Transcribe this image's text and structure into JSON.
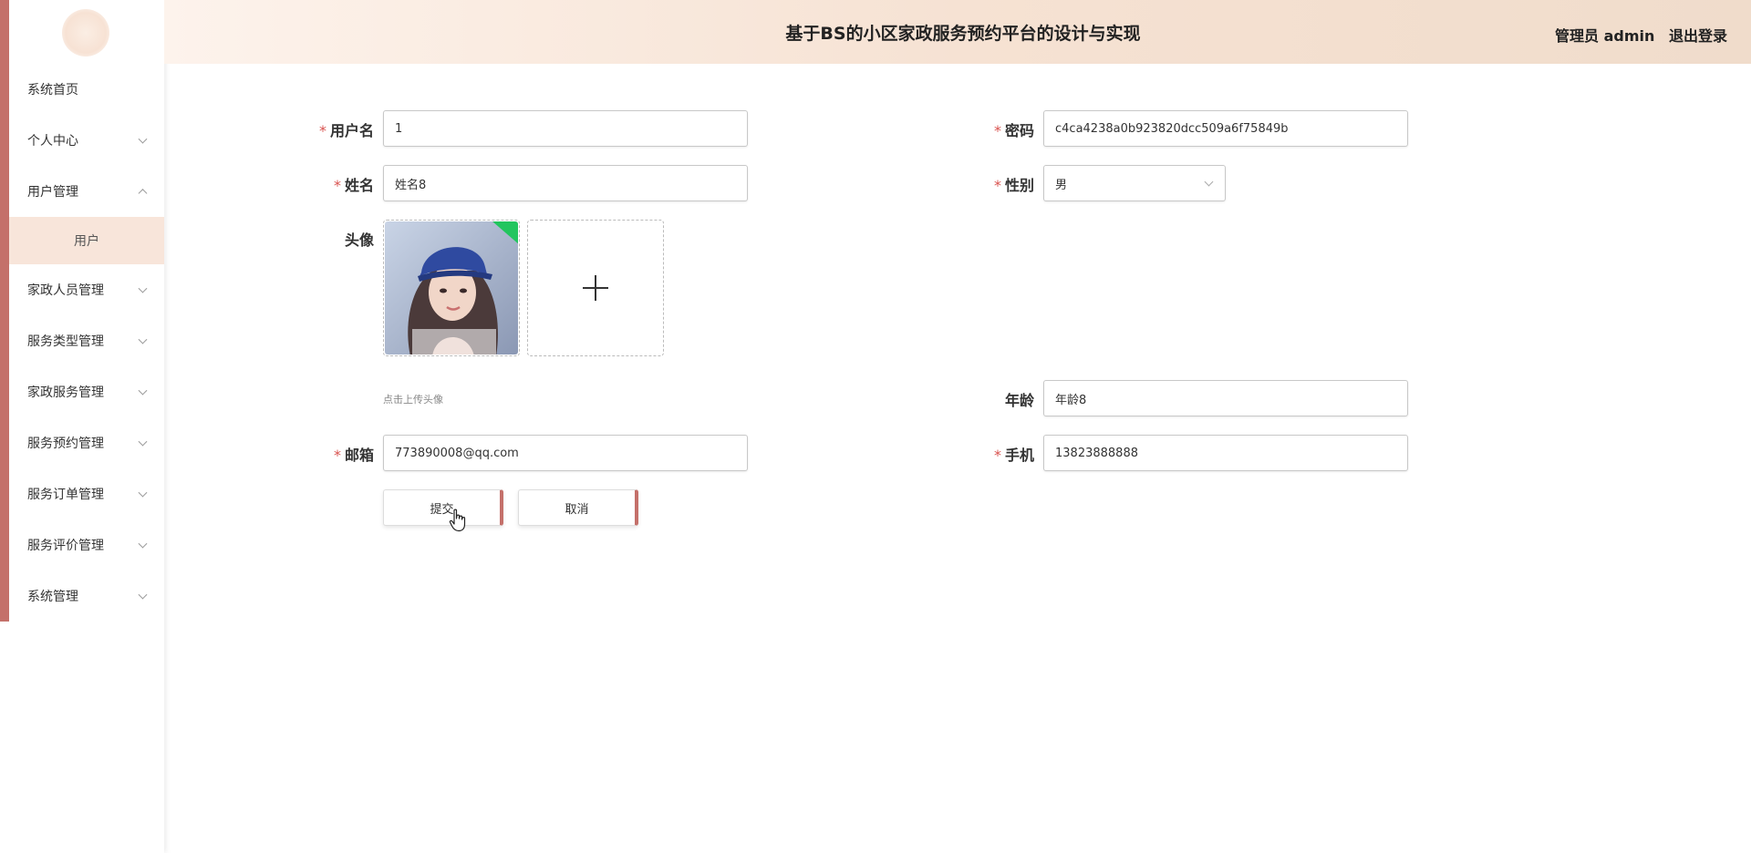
{
  "header": {
    "title": "基于BS的小区家政服务预约平台的设计与实现",
    "user_role": "管理员 admin",
    "logout_label": "退出登录"
  },
  "sidebar": {
    "items": [
      {
        "label": "系统首页",
        "has_children": false
      },
      {
        "label": "个人中心",
        "has_children": true,
        "expanded": false
      },
      {
        "label": "用户管理",
        "has_children": true,
        "expanded": true
      },
      {
        "label": "家政人员管理",
        "has_children": true,
        "expanded": false
      },
      {
        "label": "服务类型管理",
        "has_children": true,
        "expanded": false
      },
      {
        "label": "家政服务管理",
        "has_children": true,
        "expanded": false
      },
      {
        "label": "服务预约管理",
        "has_children": true,
        "expanded": false
      },
      {
        "label": "服务订单管理",
        "has_children": true,
        "expanded": false
      },
      {
        "label": "服务评价管理",
        "has_children": true,
        "expanded": false
      },
      {
        "label": "系统管理",
        "has_children": true,
        "expanded": false
      }
    ],
    "submenu": {
      "parent": "用户管理",
      "label": "用户",
      "active": true
    }
  },
  "form": {
    "username": {
      "label": "用户名",
      "required": true,
      "value": "1"
    },
    "password": {
      "label": "密码",
      "required": true,
      "value": "c4ca4238a0b923820dcc509a6f75849b"
    },
    "name": {
      "label": "姓名",
      "required": true,
      "value": "姓名8"
    },
    "gender": {
      "label": "性别",
      "required": true,
      "value": "男"
    },
    "avatar": {
      "label": "头像",
      "tip": "点击上传头像"
    },
    "age": {
      "label": "年龄",
      "required": false,
      "value": "年龄8"
    },
    "email": {
      "label": "邮箱",
      "required": true,
      "value": "773890008@qq.com"
    },
    "phone": {
      "label": "手机",
      "required": true,
      "value": "13823888888"
    },
    "required_mark": "*",
    "submit_label": "提交",
    "cancel_label": "取消"
  },
  "colors": {
    "accent": "#c4706a",
    "header_gradient_start": "#fdf3ec",
    "header_gradient_end": "#f0dccb",
    "submenu_bg": "#f8e5da",
    "required": "#d9534f"
  },
  "icons": {
    "plus": "plus-icon",
    "chevron": "chevron-down-icon",
    "cursor": "hand-cursor-icon"
  }
}
